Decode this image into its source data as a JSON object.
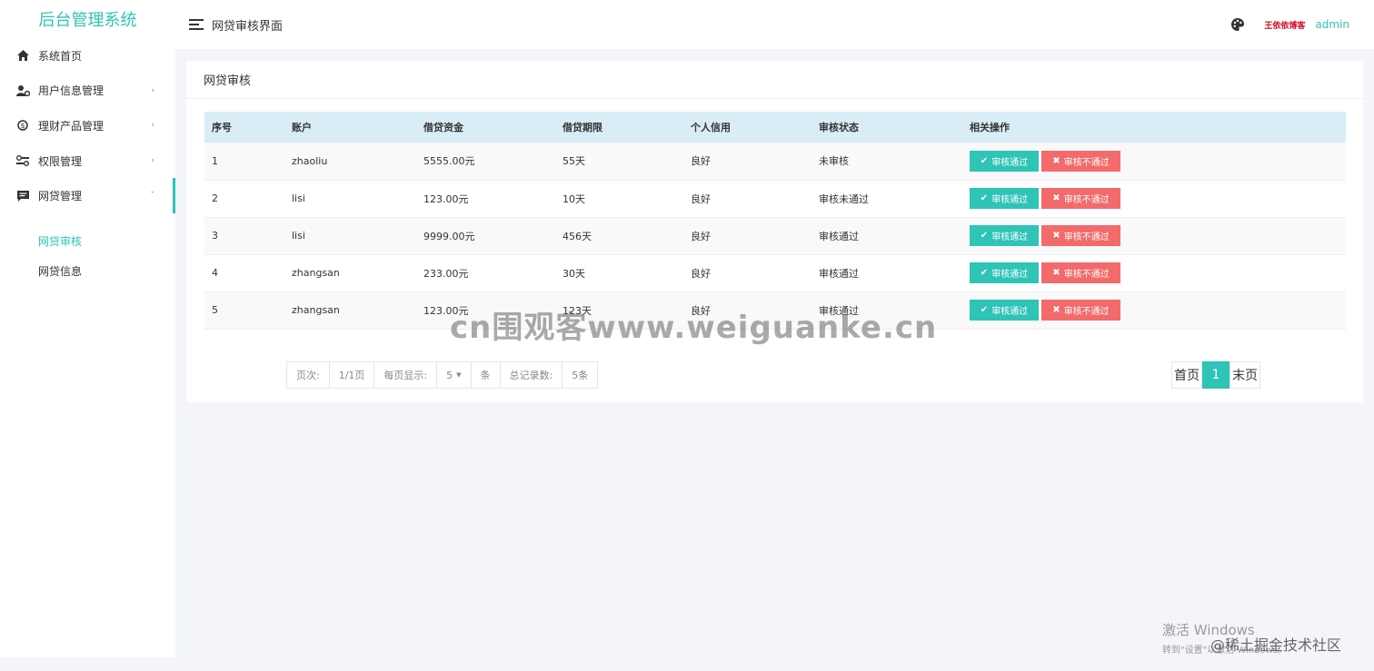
{
  "app": {
    "title": "后台管理系统"
  },
  "colors": {
    "accent": "#2ec4b6",
    "danger": "#f36a6a",
    "table_header": "#d9edf7"
  },
  "sidebar": {
    "items": [
      {
        "label": "系统首页",
        "icon": "home-icon"
      },
      {
        "label": "用户信息管理",
        "icon": "user-settings-icon"
      },
      {
        "label": "理财产品管理",
        "icon": "finance-icon"
      },
      {
        "label": "权限管理",
        "icon": "permission-icon"
      },
      {
        "label": "网贷管理",
        "icon": "message-icon"
      }
    ],
    "submenu": [
      {
        "label": "网贷审核",
        "active": true
      },
      {
        "label": "网贷信息",
        "active": false
      }
    ]
  },
  "header": {
    "title": "网贷审核界面",
    "brand_sig": "王依依博客",
    "user": "admin"
  },
  "card": {
    "title": "网贷审核"
  },
  "table": {
    "headers": [
      "序号",
      "账户",
      "借贷资金",
      "借贷期限",
      "个人信用",
      "审核状态",
      "相关操作"
    ],
    "rows": [
      {
        "no": "1",
        "account": "zhaoliu",
        "amount": "5555.00元",
        "term": "55天",
        "credit": "良好",
        "status": "未审核"
      },
      {
        "no": "2",
        "account": "lisi",
        "amount": "123.00元",
        "term": "10天",
        "credit": "良好",
        "status": "审核未通过"
      },
      {
        "no": "3",
        "account": "lisi",
        "amount": "9999.00元",
        "term": "456天",
        "credit": "良好",
        "status": "审核通过"
      },
      {
        "no": "4",
        "account": "zhangsan",
        "amount": "233.00元",
        "term": "30天",
        "credit": "良好",
        "status": "审核通过"
      },
      {
        "no": "5",
        "account": "zhangsan",
        "amount": "123.00元",
        "term": "123天",
        "credit": "良好",
        "status": "审核通过"
      }
    ],
    "approve_label": "审核通过",
    "reject_label": "审核不通过"
  },
  "pager": {
    "page_label": "页次:",
    "page_value": "1/1页",
    "per_page_label": "每页显示:",
    "per_page_value": "5",
    "per_page_unit": "条",
    "total_label": "总记录数:",
    "total_value": "5条",
    "first": "首页",
    "current": "1",
    "last": "末页"
  },
  "watermarks": {
    "center": "cn围观客www.weiguanke.cn",
    "activate_l1": "激活 Windows",
    "activate_l2": "转到\"设置\"以激活 Windows。",
    "juejin": "@稀土掘金技术社区"
  }
}
